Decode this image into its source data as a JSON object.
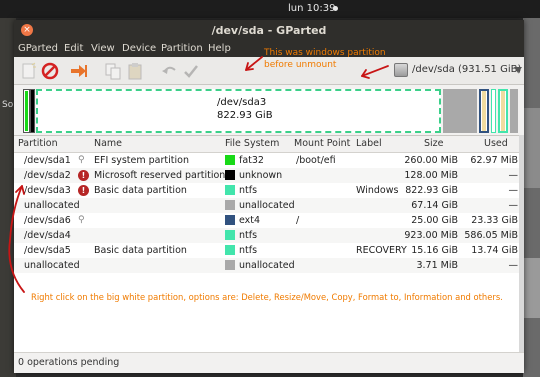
{
  "topbar": {
    "clock": "lun 10:39"
  },
  "side": {
    "left_text": "So"
  },
  "window": {
    "title": "/dev/sda - GParted",
    "close_glyph": "×"
  },
  "menu": [
    "GParted",
    "Edit",
    "View",
    "Device",
    "Partition",
    "Help"
  ],
  "toolbar": {
    "icons": [
      "new-icon",
      "delete-icon",
      "resize-move-icon",
      "copy-icon",
      "paste-icon",
      "undo-icon",
      "apply-icon"
    ],
    "device": "/dev/sda   (931.51 GiB)"
  },
  "map": {
    "name": "/dev/sda3",
    "size": "822.93 GiB"
  },
  "columns": [
    "Partition",
    "Name",
    "File System",
    "Mount Point",
    "Label",
    "Size",
    "Used"
  ],
  "rows": [
    {
      "partition": "/dev/sda1",
      "flag": "key",
      "name": "EFI system partition",
      "fs": "fat32",
      "fs_color": "#18d918",
      "mount": "/boot/efi",
      "label": "",
      "size": "260.00 MiB",
      "used": "62.97 MiB"
    },
    {
      "partition": "/dev/sda2",
      "flag": "warn",
      "name": "Microsoft reserved partition",
      "fs": "unknown",
      "fs_color": "#000000",
      "mount": "",
      "label": "",
      "size": "128.00 MiB",
      "used": "—"
    },
    {
      "partition": "/dev/sda3",
      "flag": "warn",
      "name": "Basic data partition",
      "fs": "ntfs",
      "fs_color": "#42e5ac",
      "mount": "",
      "label": "Windows",
      "size": "822.93 GiB",
      "used": "—"
    },
    {
      "partition": "unallocated",
      "flag": "",
      "name": "",
      "fs": "unallocated",
      "fs_color": "#a9a9a9",
      "mount": "",
      "label": "",
      "size": "67.14 GiB",
      "used": "—"
    },
    {
      "partition": "/dev/sda6",
      "flag": "key",
      "name": "",
      "fs": "ext4",
      "fs_color": "#31527f",
      "mount": "/",
      "label": "",
      "size": "25.00 GiB",
      "used": "23.33 GiB"
    },
    {
      "partition": "/dev/sda4",
      "flag": "",
      "name": "",
      "fs": "ntfs",
      "fs_color": "#42e5ac",
      "mount": "",
      "label": "",
      "size": "923.00 MiB",
      "used": "586.05 MiB"
    },
    {
      "partition": "/dev/sda5",
      "flag": "",
      "name": "Basic data partition",
      "fs": "ntfs",
      "fs_color": "#42e5ac",
      "mount": "",
      "label": "RECOVERY",
      "size": "15.16 GiB",
      "used": "13.74 GiB"
    },
    {
      "partition": "unallocated",
      "flag": "",
      "name": "",
      "fs": "unallocated",
      "fs_color": "#a9a9a9",
      "mount": "",
      "label": "",
      "size": "3.71 MiB",
      "used": "—"
    }
  ],
  "status": "0 operations pending",
  "annotations": {
    "line1": "This was windows partition",
    "line2": "before unmount",
    "bottom": "Right click on the big white partition, options are: Delete, Resize/Move, Copy, Format to, Information and others."
  }
}
